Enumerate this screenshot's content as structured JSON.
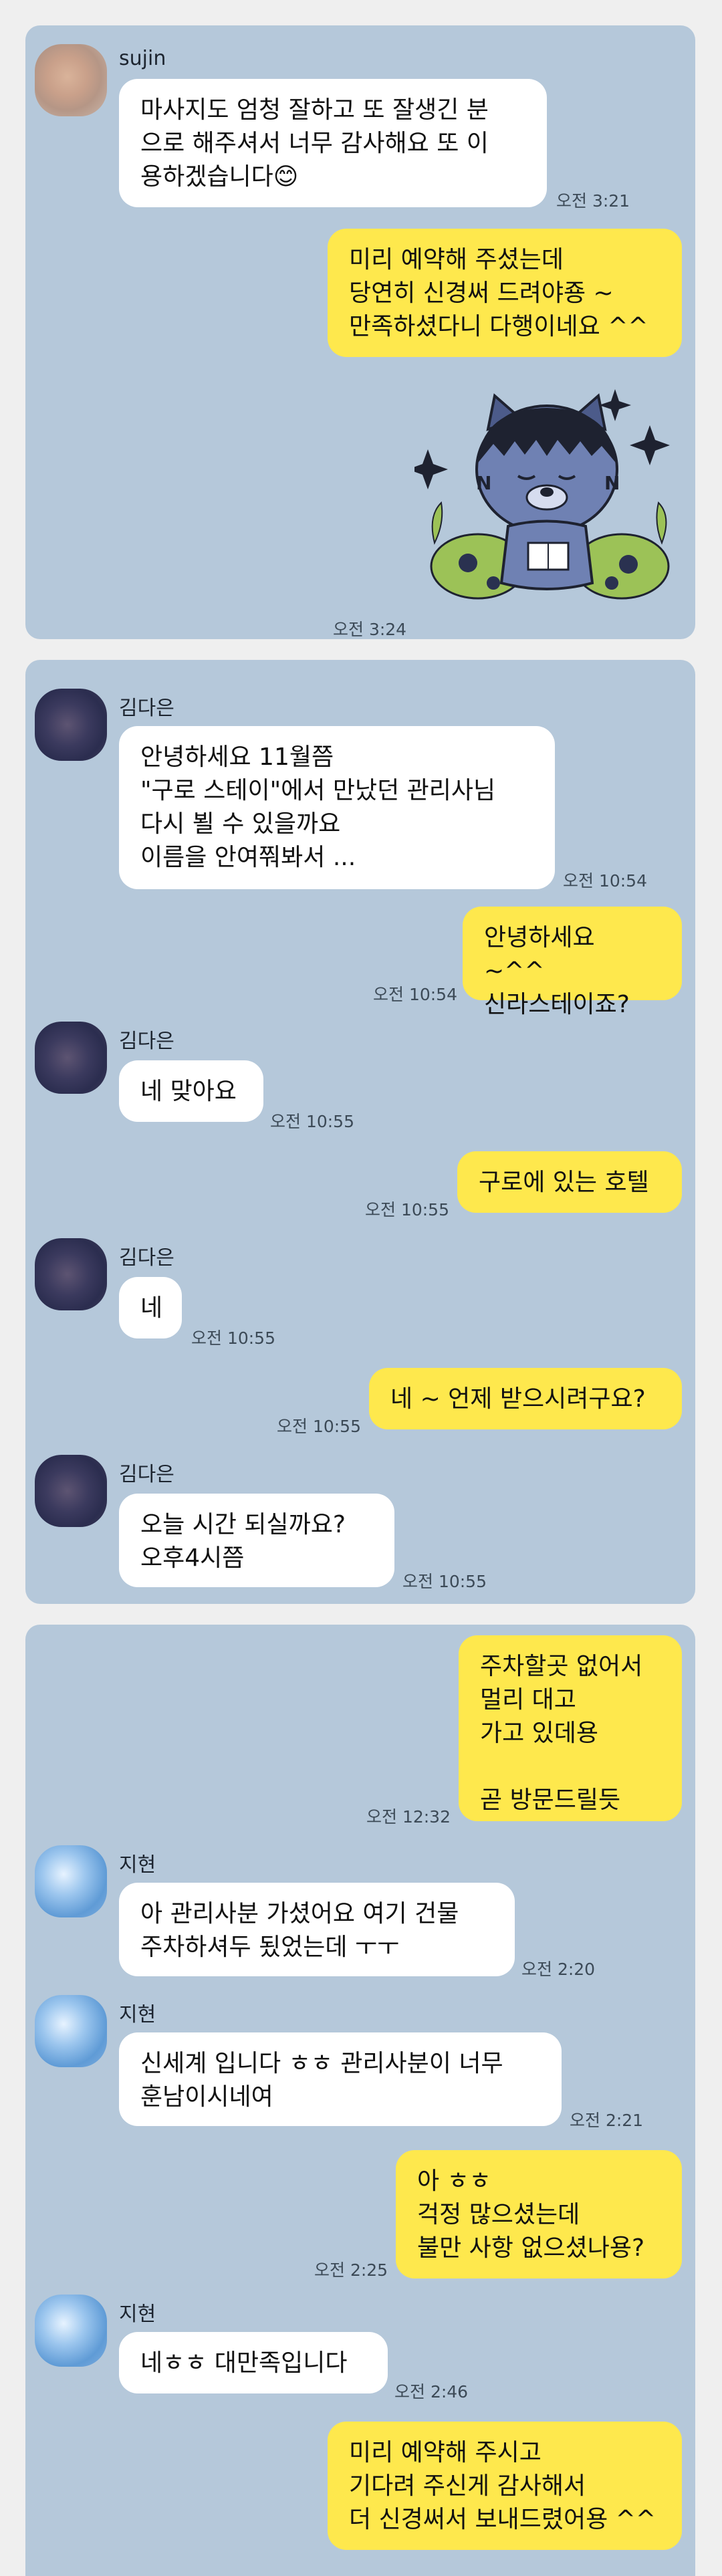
{
  "panel1": {
    "contact_name": "sujin",
    "msg1": {
      "text": "마사지도 엄청 잘하고 또 잘생긴 분\n으로 해주셔서 너무 감사해요 또 이\n용하겠습니다😊",
      "time": "오전 3:21"
    },
    "msg2": {
      "text": "미리 예약해 주셨는데\n당연히 신경써 드려야죵 ~\n만족하셨다니 다행이네요 ^^"
    },
    "sticker_time": "오전 3:24"
  },
  "panel2": {
    "contact_name": "김다은",
    "msg1": {
      "text": "안녕하세요 11월쯤\n\"구로 스테이\"에서 만났던 관리사님\n다시 뵐 수 있을까요\n이름을 안여쭤봐서 ...",
      "time": "오전 10:54"
    },
    "msg2": {
      "text": "안녕하세요 ~^^\n신라스테이죠?",
      "time": "오전 10:54"
    },
    "msg3": {
      "text": "네 맞아요",
      "time": "오전 10:55"
    },
    "msg4": {
      "text": "구로에 있는 호텔",
      "time": "오전 10:55"
    },
    "msg5": {
      "text": "네",
      "time": "오전 10:55"
    },
    "msg6": {
      "text": "네 ~ 언제 받으시려구요?",
      "time": "오전 10:55"
    },
    "msg7": {
      "text": "오늘  시간 되실까요?\n오후4시쯤",
      "time": "오전 10:55"
    }
  },
  "panel3": {
    "contact_name": "지현",
    "msg1": {
      "text": "주차할곳 없어서\n멀리 대고\n가고 있데용\n\n곧 방문드릴듯",
      "time": "오전 12:32"
    },
    "msg2": {
      "text": "아 관리사분 가셨어요 여기 건물\n주차하셔두 됬었는데 ㅜㅜ",
      "time": "오전 2:20"
    },
    "msg3": {
      "text": "신세계 입니다 ㅎㅎ 관리사분이 너무\n훈남이시네여",
      "time": "오전 2:21"
    },
    "msg4": {
      "text": "아 ㅎㅎ\n걱정 많으셨는데\n불만 사항 없으셨나용?",
      "time": "오전 2:25"
    },
    "msg5": {
      "text": "네ㅎㅎ 대만족입니다",
      "time": "오전 2:46"
    },
    "msg6": {
      "text": "미리 예약해 주시고\n기다려 주신게 감사해서\n더 신경써서 보내드렸어용 ^^"
    }
  },
  "colors": {
    "background": "#efefef",
    "panel": "#b5c8da",
    "incoming_bubble": "#ffffff",
    "outgoing_bubble": "#fee84d"
  },
  "icons": {
    "sticker": "kakao-ryan-sleepy-sticker",
    "avatar1": "blurred-avatar",
    "avatar2": "blurred-avatar",
    "avatar3": "blurred-avatar"
  }
}
